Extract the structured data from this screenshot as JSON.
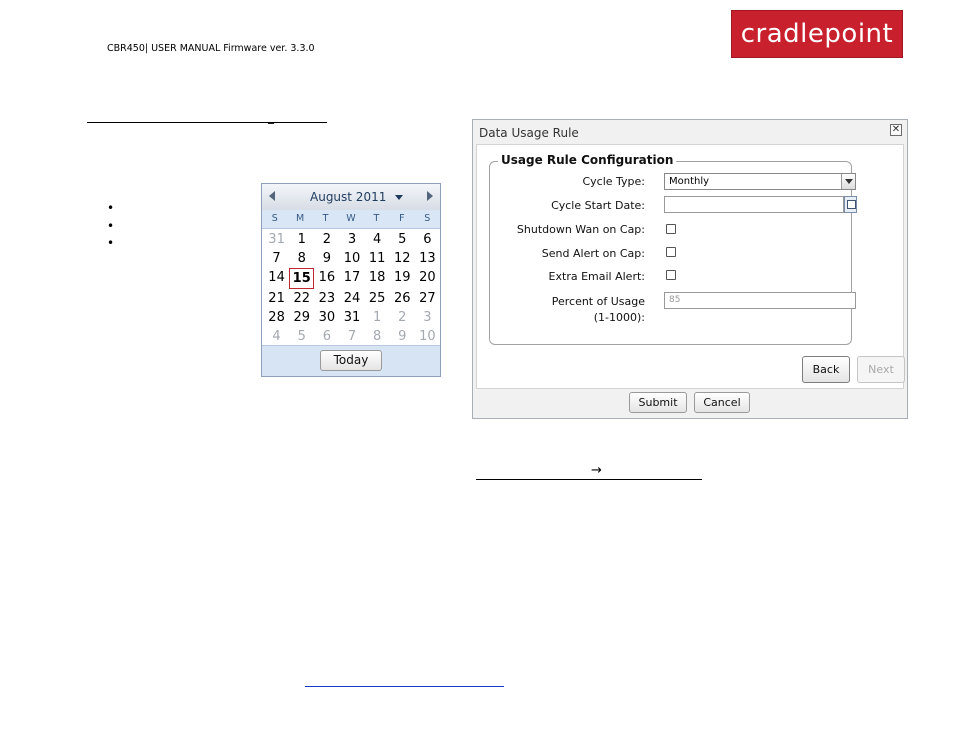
{
  "header": {
    "doc_title": "CBR450| USER MANUAL Firmware ver. 3.3.0",
    "logo_text": "cradlepoint",
    "logo_color": "#c8202d"
  },
  "left": {
    "dash": "_",
    "bullets": [
      "•",
      "•",
      "•"
    ]
  },
  "calendar": {
    "month_label": "August 2011",
    "weekdays": [
      "S",
      "M",
      "T",
      "W",
      "T",
      "F",
      "S"
    ],
    "days": [
      "31",
      "1",
      "2",
      "3",
      "4",
      "5",
      "6",
      "7",
      "8",
      "9",
      "10",
      "11",
      "12",
      "13",
      "14",
      "15",
      "16",
      "17",
      "18",
      "19",
      "20",
      "21",
      "22",
      "23",
      "24",
      "25",
      "26",
      "27",
      "28",
      "29",
      "30",
      "31",
      "1",
      "2",
      "3",
      "4",
      "5",
      "6",
      "7",
      "8",
      "9",
      "10"
    ],
    "today_label": "Today",
    "selected_day": "15"
  },
  "dialog": {
    "title": "Data Usage Rule",
    "close_glyph": "✕",
    "legend": "Usage Rule Configuration",
    "fields": {
      "cycle_type_label": "Cycle Type:",
      "cycle_type_value": "Monthly",
      "cycle_start_label": "Cycle Start Date:",
      "cycle_start_value": "",
      "shutdown_label": "Shutdown Wan on Cap:",
      "send_alert_label": "Send Alert on Cap:",
      "extra_email_label": "Extra Email Alert:",
      "percent_label_1": "Percent of Usage",
      "percent_label_2": "(1-1000):",
      "percent_value": "85"
    },
    "back_label": "Back",
    "next_label": "Next",
    "submit_label": "Submit",
    "cancel_label": "Cancel"
  },
  "below": {
    "arrow": "→"
  }
}
